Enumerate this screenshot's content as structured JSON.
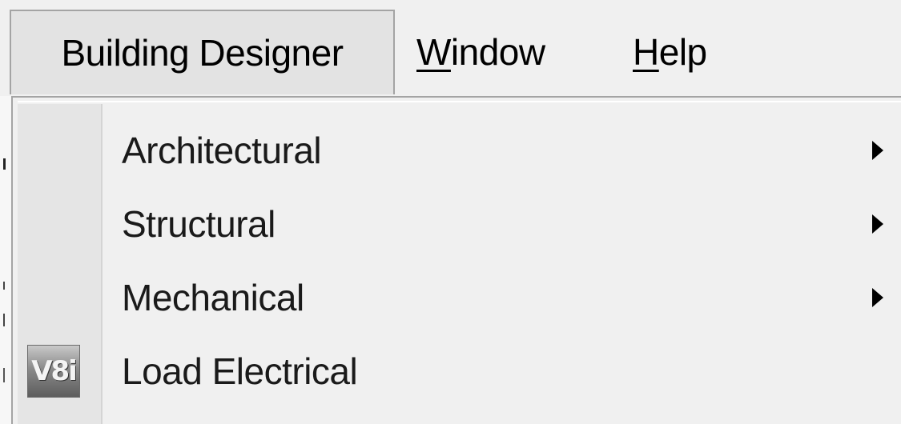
{
  "menubar": {
    "items": [
      {
        "label": "Building Designer",
        "state": "open"
      },
      {
        "prefix": "",
        "mnemonic": "W",
        "rest": "indow"
      },
      {
        "prefix": "",
        "mnemonic": "H",
        "rest": "elp"
      }
    ]
  },
  "dropdown": {
    "items": [
      {
        "label": "Architectural",
        "has_submenu": true
      },
      {
        "label": "Structural",
        "has_submenu": true
      },
      {
        "label": "Mechanical",
        "has_submenu": true
      },
      {
        "label": "Load Electrical",
        "has_submenu": false,
        "icon": "v8i-icon",
        "icon_text": "V8i"
      }
    ]
  },
  "colors": {
    "menu_background": "#f0f0f0",
    "active_menu_background": "#e3e3e3",
    "border": "#a4a4a4",
    "icon_column": "#e5e5e5"
  }
}
